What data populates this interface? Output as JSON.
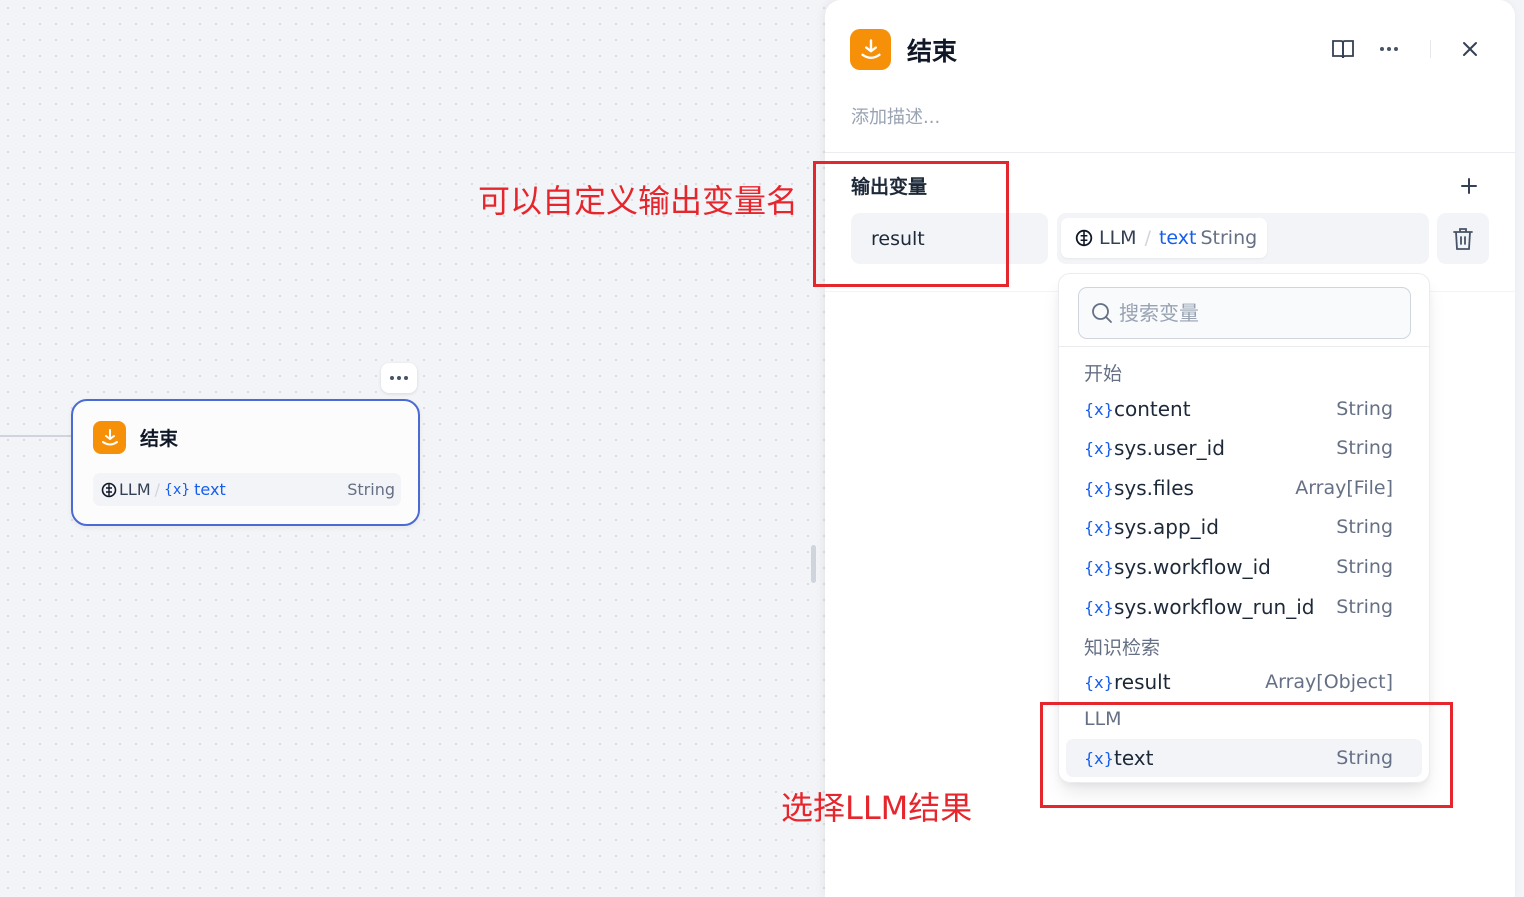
{
  "node": {
    "title": "结束",
    "var_source": "LLM",
    "var_separator": "/",
    "var_token": "{x}",
    "var_name": "text",
    "var_type": "String"
  },
  "panel": {
    "title": "结束",
    "description_placeholder": "添加描述...",
    "section_title": "输出变量",
    "output": {
      "name": "result",
      "source": "LLM",
      "separator": "/",
      "var_name": "text",
      "var_type": "String"
    }
  },
  "dropdown": {
    "search_placeholder": "搜索变量",
    "token": "{x}",
    "groups": [
      {
        "label": "开始",
        "items": [
          {
            "name": "content",
            "type": "String"
          },
          {
            "name": "sys.user_id",
            "type": "String"
          },
          {
            "name": "sys.files",
            "type": "Array[File]"
          },
          {
            "name": "sys.app_id",
            "type": "String"
          },
          {
            "name": "sys.workflow_id",
            "type": "String"
          },
          {
            "name": "sys.workflow_run_id",
            "type": "String"
          }
        ]
      },
      {
        "label": "知识检索",
        "items": [
          {
            "name": "result",
            "type": "Array[Object]"
          }
        ]
      },
      {
        "label": "LLM",
        "items": [
          {
            "name": "text",
            "type": "String"
          }
        ]
      }
    ]
  },
  "annotations": {
    "custom_name": "可以自定义输出变量名",
    "select_llm": "选择LLM结果"
  },
  "colors": {
    "node_border": "#4a6ad6",
    "node_icon": "#f79009",
    "variable_blue": "#155eef",
    "annotation_red": "#e5262c"
  }
}
